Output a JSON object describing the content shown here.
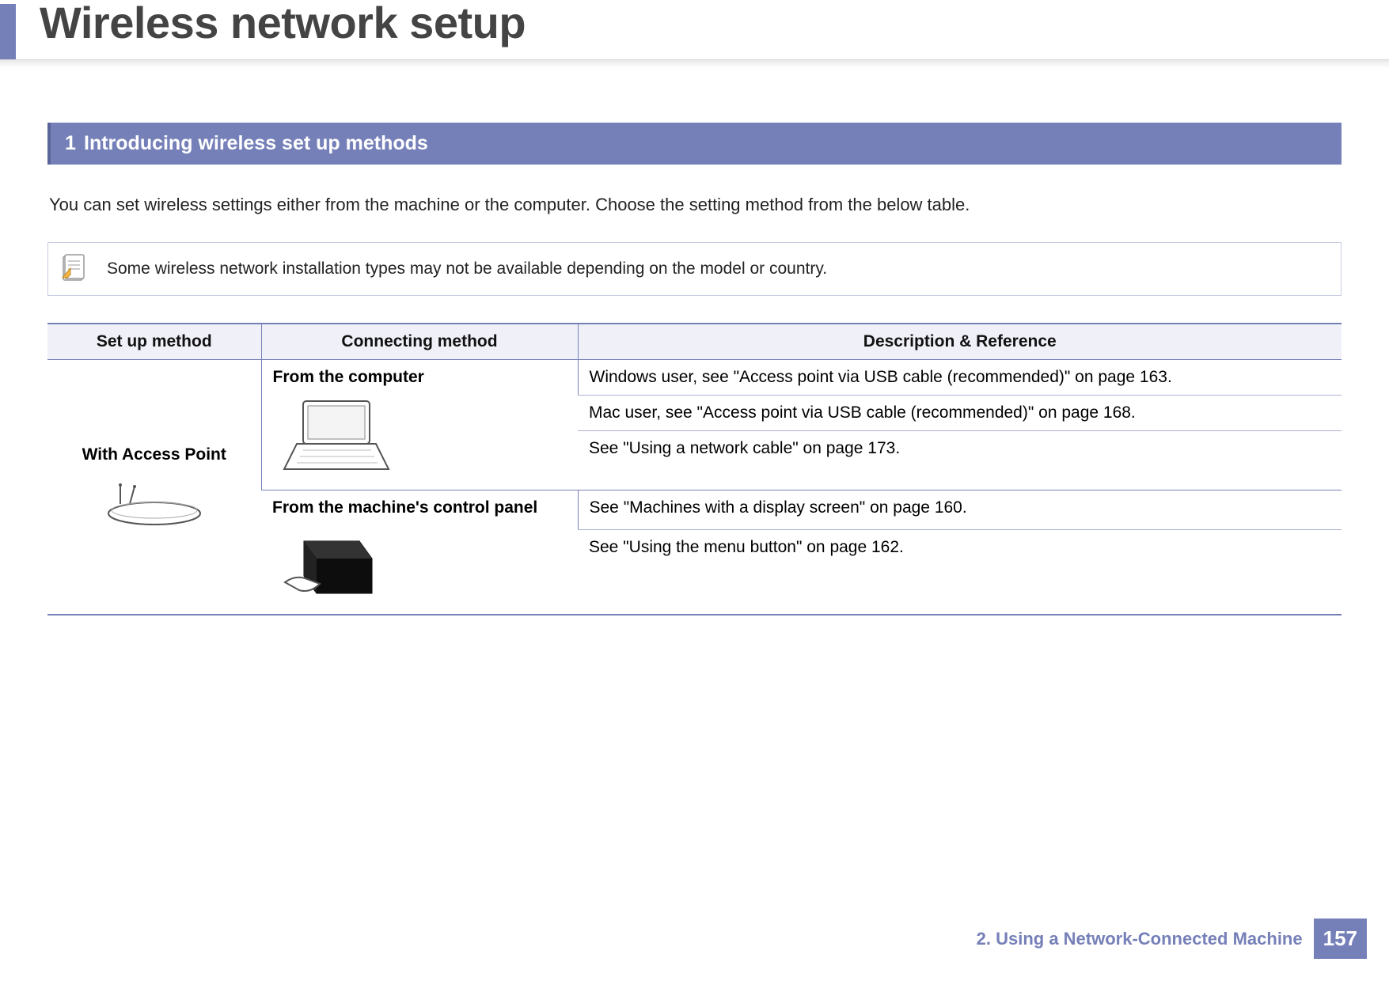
{
  "page_title": "Wireless network setup",
  "section_numbered_bold": "1",
  "section_heading": "Introducing wireless set up methods",
  "intro_paragraph": "You can set wireless settings either from the machine or the computer. Choose the setting method from the below table.",
  "note_text": "Some wireless network installation types may not be available depending on the model or country.",
  "table": {
    "headers": {
      "setup": "Set up method",
      "connecting": "Connecting method",
      "description": "Description & Reference"
    },
    "setup_method": "With Access Point",
    "connecting_from_computer": "From the computer",
    "connecting_from_panel": "From the machine's control panel",
    "desc_win": "Windows user, see \"Access point via USB cable (recommended)\" on page 163.",
    "desc_mac": "Mac user, see \"Access point via USB cable (recommended)\" on page 168.",
    "desc_netcable": "See \"Using a network cable\" on page 173.",
    "desc_display": "See \"Machines with a display screen\" on page 160.",
    "desc_menubtn": "See \"Using the menu button\" on page 162."
  },
  "footer": {
    "chapter": "2.  Using a Network-Connected Machine",
    "page_number": "157"
  }
}
